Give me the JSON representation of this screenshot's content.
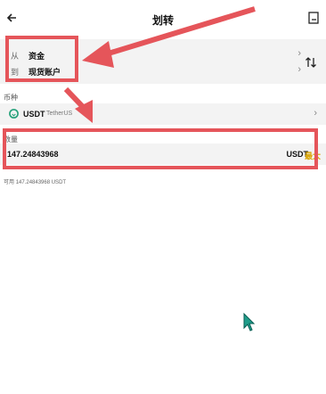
{
  "header": {
    "title": "划转"
  },
  "transfer": {
    "from_label": "从",
    "from_value": "资金",
    "to_label": "到",
    "to_value": "现货账户"
  },
  "coin": {
    "section_label": "币种",
    "symbol": "USDT",
    "name": "TetherUS"
  },
  "amount": {
    "section_label": "数量",
    "value": "147.24843968",
    "unit": "USDT",
    "max_label": "最大"
  },
  "available": {
    "label": "可用",
    "value": "147.24843968 USDT"
  },
  "colors": {
    "annotation": "#e5555a",
    "accent": "#d9a400",
    "coin_icon": "#26a17b",
    "cursor": "#1f9d8a"
  },
  "icons": [
    "back-arrow-icon",
    "history-icon",
    "swap-icon",
    "chevron-right-icon",
    "usdt-icon",
    "mouse-cursor-icon"
  ]
}
